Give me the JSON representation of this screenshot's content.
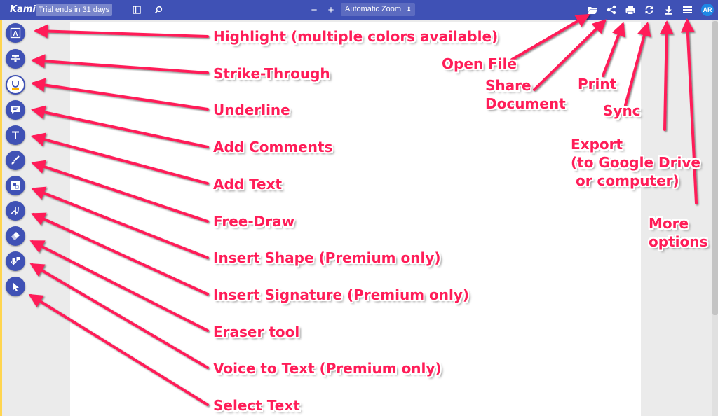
{
  "app": {
    "brand": "Kami",
    "trial": "Trial ends in 31 days",
    "avatar": "AR"
  },
  "toolbar": {
    "zoom_out": "−",
    "zoom_in": "+",
    "zoom_value": "Automatic Zoom",
    "zoom_caret": "⬍",
    "icons": [
      "sidebar-icon",
      "search-icon",
      "folder-open-icon",
      "share-icon",
      "print-icon",
      "sync-icon",
      "download-icon",
      "menu-icon"
    ]
  },
  "tools": [
    {
      "name": "highlight-tool",
      "icon": "highlight-icon"
    },
    {
      "name": "strikethrough-tool",
      "icon": "strikethrough-icon"
    },
    {
      "name": "underline-tool",
      "icon": "underline-icon"
    },
    {
      "name": "comment-tool",
      "icon": "comment-icon"
    },
    {
      "name": "text-tool",
      "icon": "text-icon"
    },
    {
      "name": "draw-tool",
      "icon": "brush-icon"
    },
    {
      "name": "shape-tool",
      "icon": "shape-icon"
    },
    {
      "name": "signature-tool",
      "icon": "signature-icon"
    },
    {
      "name": "eraser-tool",
      "icon": "eraser-icon"
    },
    {
      "name": "voice-tool",
      "icon": "microphone-icon"
    },
    {
      "name": "select-tool",
      "icon": "cursor-icon"
    }
  ],
  "annotations": {
    "left": [
      "Highlight (multiple colors available)",
      "Strike-Through",
      "Underline",
      "Add Comments",
      "Add Text",
      "Free-Draw",
      "Insert Shape (Premium only)",
      "Insert Signature (Premium only)",
      "Eraser tool",
      "Voice to Text (Premium only)",
      "Select Text"
    ],
    "right": {
      "open_file": "Open File",
      "share_1": "Share",
      "share_2": "Document",
      "print": "Print",
      "sync": "Sync",
      "export_1": "Export",
      "export_2": "(to Google Drive",
      "export_3": " or computer)",
      "more_1": "More",
      "more_2": "options"
    },
    "arrow_color": "#ff1d58"
  },
  "colors": {
    "toolbar": "#3f51b5",
    "tool_button": "#3f51b5",
    "accent_rail": "#ffd54f"
  }
}
